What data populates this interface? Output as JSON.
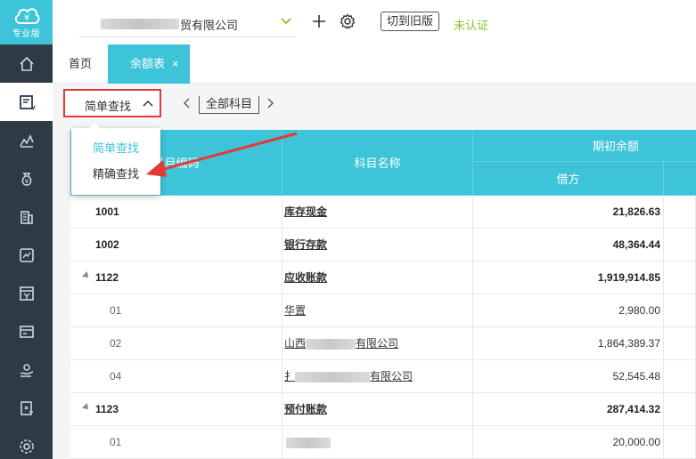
{
  "sidebar": {
    "logo_text": "专业版",
    "items": [
      "home-icon",
      "voucher-icon",
      "report-icon",
      "money-bag-icon",
      "building-icon",
      "chart-board-icon",
      "cashier-icon",
      "invoice-icon",
      "hand-coin-icon",
      "export-icon",
      "settings-icon"
    ]
  },
  "header": {
    "company_name": "贸有限公司",
    "switch_old_label": "切到旧版",
    "status": "未认证"
  },
  "tabs": {
    "home": "首页",
    "active": "余额表",
    "close": "×"
  },
  "toolbar": {
    "find_mode": "简单查找",
    "subject_range": "全部科目",
    "prev": "‹",
    "next": "›"
  },
  "dropdown": {
    "options": [
      "简单查找",
      "精确查找"
    ]
  },
  "table": {
    "headers": {
      "code": "科目编码",
      "name": "科目名称",
      "opening": "期初余额",
      "debit": "借方"
    },
    "rows": [
      {
        "code": "1001",
        "name": "库存现金",
        "debit": "21,826.63",
        "level": 1
      },
      {
        "code": "1002",
        "name": "银行存款",
        "debit": "48,364.44",
        "level": 1
      },
      {
        "code": "1122",
        "name": "应收账款",
        "debit": "1,919,914.85",
        "level": 1
      },
      {
        "code": "01",
        "name": "华置",
        "debit": "2,980.00",
        "level": 2
      },
      {
        "code": "02",
        "name_prefix": "山西",
        "name": "有限公司",
        "debit": "1,864,389.37",
        "level": 2
      },
      {
        "code": "04",
        "name_prefix": "扌",
        "name": "有限公司",
        "debit": "52,545.48",
        "level": 2
      },
      {
        "code": "1123",
        "name": "预付账款",
        "debit": "287,414.32",
        "level": 1
      },
      {
        "code": "01",
        "name_prefix": "",
        "name": "",
        "debit": "20,000.00",
        "level": 2
      }
    ]
  },
  "colors": {
    "accent": "#3dc4d8",
    "sidebar": "#2f3a47",
    "highlight": "#e53935",
    "status": "#8cbd2d"
  }
}
